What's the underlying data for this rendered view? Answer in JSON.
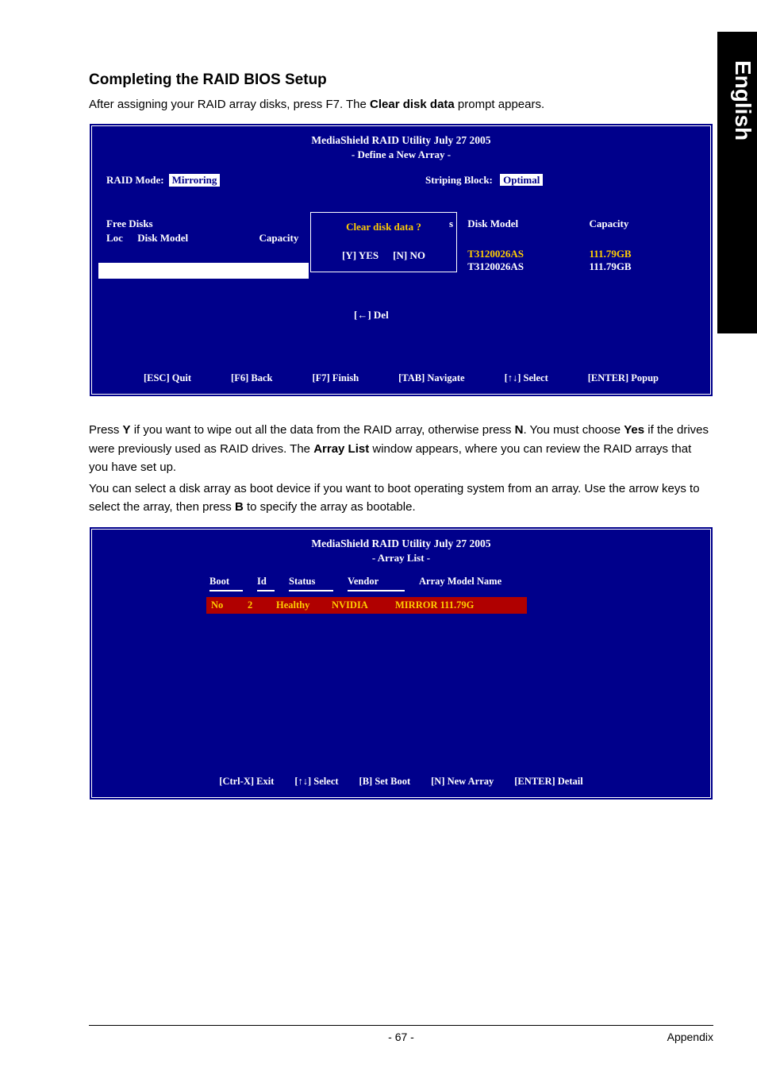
{
  "sideTab": "English",
  "heading": "Completing the RAID BIOS Setup",
  "intro_before": "After assigning your RAID array disks, press F7. The ",
  "intro_bold": "Clear disk data",
  "intro_after": " prompt appears.",
  "bios1": {
    "title": "MediaShield RAID Utility  July 27 2005",
    "subtitle": "- Define a New Array -",
    "raidModeLabel": "RAID Mode:",
    "raidModeValue": "Mirroring",
    "stripingLabel": "Striping Block:",
    "stripingValue": "Optimal",
    "freeDisksLabel": "Free Disks",
    "locLabel": "Loc",
    "diskModelLabel": "Disk Model",
    "capacityLabel": "Capacity",
    "dialogTitle": "Clear disk data ?",
    "optYes": "[Y] YES",
    "optNo": "[N] NO",
    "delHint": "[←] Del",
    "rightSLabel": "s",
    "rightDiskModelLabel": "Disk Model",
    "rightCapacityLabel": "Capacity",
    "disk1Model": "T3120026AS",
    "disk1Cap": "111.79GB",
    "disk2Model": "T3120026AS",
    "disk2Cap": "111.79GB",
    "hints": {
      "esc": "[ESC] Quit",
      "f6": "[F6] Back",
      "f7": "[F7] Finish",
      "tab": "[TAB] Navigate",
      "arrows": "[↑↓] Select",
      "enter": "[ENTER] Popup"
    }
  },
  "para2_1a": "Press ",
  "para2_1b": "Y",
  "para2_1c": " if you want to wipe out all the data from the RAID array, otherwise press ",
  "para2_1d": "N",
  "para2_1e": ". You must choose ",
  "para2_1f": "Yes",
  "para2_1g": " if the drives were previously used as RAID drives. The ",
  "para2_1h": "Array List",
  "para2_1i": " window appears, where you can review the RAID arrays that you have set up.",
  "para2_2a": "You can select a disk array as boot device if you want to boot operating system from an array. Use the arrow keys to select the array, then press ",
  "para2_2b": "B",
  "para2_2c": " to specify the array as bootable.",
  "bios2": {
    "title": "MediaShield RAID Utility  July 27 2005",
    "subtitle": "- Array List -",
    "headers": {
      "boot": "Boot",
      "id": "Id",
      "status": "Status",
      "vendor": "Vendor",
      "name": "Array Model Name"
    },
    "row": {
      "boot": "No",
      "id": "2",
      "status": "Healthy",
      "vendor": "NVIDIA",
      "name": "MIRROR  111.79G"
    },
    "hints": {
      "exit": "[Ctrl-X] Exit",
      "select": "[↑↓] Select",
      "setboot": "[B] Set Boot",
      "newarray": "[N] New Array",
      "detail": "[ENTER] Detail"
    }
  },
  "footer": {
    "page": "- 67 -",
    "section": "Appendix"
  }
}
